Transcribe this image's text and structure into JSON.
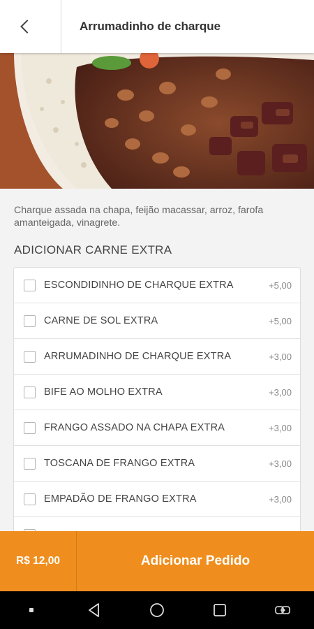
{
  "header": {
    "title": "Arrumadinho de charque"
  },
  "product": {
    "description": "Charque assada na chapa, feijão macassar, arroz, farofa amanteigada, vinagrete."
  },
  "extras": {
    "section_title": "ADICIONAR CARNE EXTRA",
    "items": [
      {
        "label": "ESCONDIDINHO DE CHARQUE EXTRA",
        "price": "+5,00",
        "checked": false
      },
      {
        "label": "CARNE DE SOL EXTRA",
        "price": "+5,00",
        "checked": false
      },
      {
        "label": "ARRUMADINHO DE CHARQUE EXTRA",
        "price": "+3,00",
        "checked": false
      },
      {
        "label": "BIFE AO MOLHO EXTRA",
        "price": "+3,00",
        "checked": false
      },
      {
        "label": "FRANGO ASSADO NA CHAPA EXTRA",
        "price": "+3,00",
        "checked": false
      },
      {
        "label": "TOSCANA DE FRANGO EXTRA",
        "price": "+3,00",
        "checked": false
      },
      {
        "label": "EMPADÃO DE FRANGO EXTRA",
        "price": "+3,00",
        "checked": false
      }
    ]
  },
  "order": {
    "price": "R$ 12,00",
    "button_label": "Adicionar Pedido"
  },
  "nav": {
    "icons": [
      "menu-dot-icon",
      "back-triangle-icon",
      "home-circle-icon",
      "recents-square-icon",
      "switch-apps-icon"
    ]
  },
  "colors": {
    "accent": "#ef8e1e",
    "header_bg": "#ffffff",
    "page_bg": "#f3f3f3"
  }
}
